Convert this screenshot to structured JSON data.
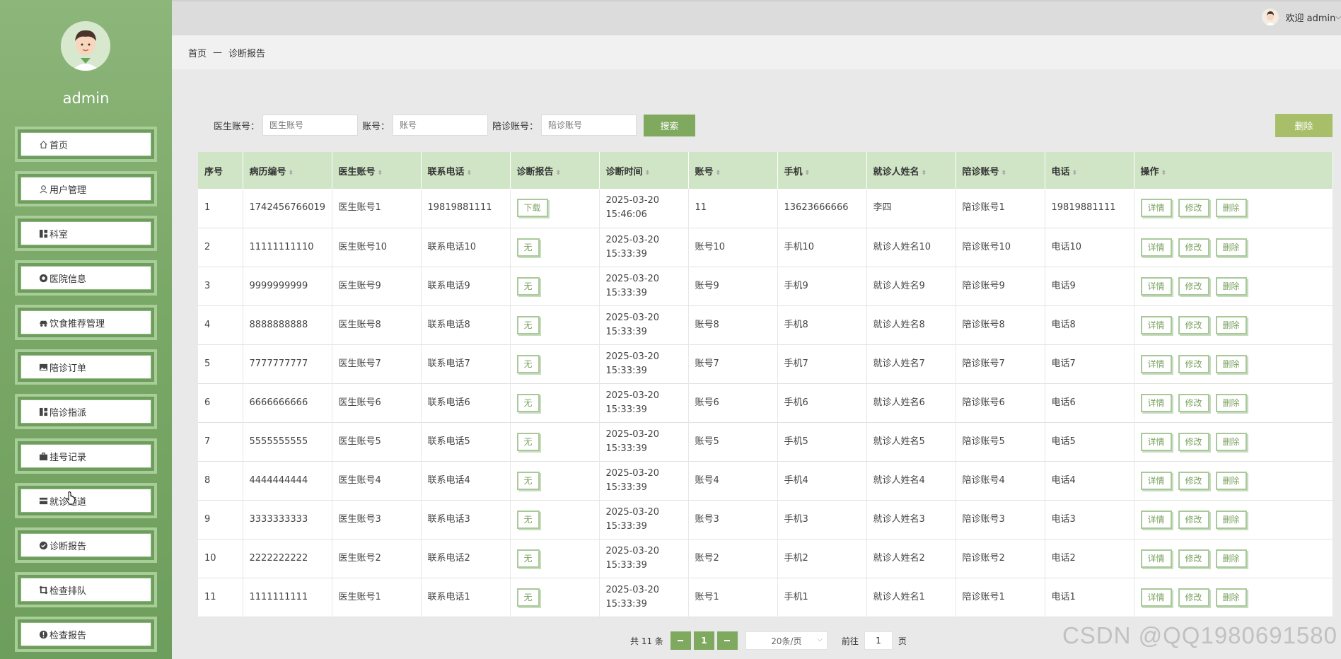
{
  "user": {
    "name": "admin",
    "welcome": "欢迎 admin"
  },
  "sidebar": {
    "items": [
      {
        "label": "首页",
        "icon": "home-icon"
      },
      {
        "label": "用户管理",
        "icon": "user-icon"
      },
      {
        "label": "科室",
        "icon": "grid-icon"
      },
      {
        "label": "医院信息",
        "icon": "info-icon"
      },
      {
        "label": "饮食推荐管理",
        "icon": "car-icon"
      },
      {
        "label": "陪诊订单",
        "icon": "image-icon"
      },
      {
        "label": "陪诊指派",
        "icon": "grid-icon"
      },
      {
        "label": "挂号记录",
        "icon": "bag-icon"
      },
      {
        "label": "就诊通道",
        "icon": "card-icon"
      },
      {
        "label": "诊断报告",
        "icon": "check-icon"
      },
      {
        "label": "检查排队",
        "icon": "crop-icon"
      },
      {
        "label": "检查报告",
        "icon": "alert-icon"
      }
    ]
  },
  "breadcrumb": {
    "home": "首页",
    "sep": "—",
    "current": "诊断报告"
  },
  "search": {
    "doctor_label": "医生账号：",
    "doctor_placeholder": "医生账号",
    "account_label": "账号：",
    "account_placeholder": "账号",
    "escort_label": "陪诊账号：",
    "escort_placeholder": "陪诊账号",
    "search_button": "搜索",
    "delete_button": "删除"
  },
  "table": {
    "headers": [
      "序号",
      "病历编号",
      "医生账号",
      "联系电话",
      "诊断报告",
      "诊断时间",
      "账号",
      "手机",
      "就诊人姓名",
      "陪诊账号",
      "电话",
      "操作"
    ],
    "actions": {
      "detail": "详情",
      "edit": "修改",
      "delete": "删除"
    },
    "rows": [
      [
        "1",
        "1742456766019",
        "医生账号1",
        "19819881111",
        "下载",
        "2025-03-20 15:46:06",
        "11",
        "13623666666",
        "李四",
        "陪诊账号1",
        "19819881111"
      ],
      [
        "2",
        "11111111110",
        "医生账号10",
        "联系电话10",
        "无",
        "2025-03-20 15:33:39",
        "账号10",
        "手机10",
        "就诊人姓名10",
        "陪诊账号10",
        "电话10"
      ],
      [
        "3",
        "9999999999",
        "医生账号9",
        "联系电话9",
        "无",
        "2025-03-20 15:33:39",
        "账号9",
        "手机9",
        "就诊人姓名9",
        "陪诊账号9",
        "电话9"
      ],
      [
        "4",
        "8888888888",
        "医生账号8",
        "联系电话8",
        "无",
        "2025-03-20 15:33:39",
        "账号8",
        "手机8",
        "就诊人姓名8",
        "陪诊账号8",
        "电话8"
      ],
      [
        "5",
        "7777777777",
        "医生账号7",
        "联系电话7",
        "无",
        "2025-03-20 15:33:39",
        "账号7",
        "手机7",
        "就诊人姓名7",
        "陪诊账号7",
        "电话7"
      ],
      [
        "6",
        "6666666666",
        "医生账号6",
        "联系电话6",
        "无",
        "2025-03-20 15:33:39",
        "账号6",
        "手机6",
        "就诊人姓名6",
        "陪诊账号6",
        "电话6"
      ],
      [
        "7",
        "5555555555",
        "医生账号5",
        "联系电话5",
        "无",
        "2025-03-20 15:33:39",
        "账号5",
        "手机5",
        "就诊人姓名5",
        "陪诊账号5",
        "电话5"
      ],
      [
        "8",
        "4444444444",
        "医生账号4",
        "联系电话4",
        "无",
        "2025-03-20 15:33:39",
        "账号4",
        "手机4",
        "就诊人姓名4",
        "陪诊账号4",
        "电话4"
      ],
      [
        "9",
        "3333333333",
        "医生账号3",
        "联系电话3",
        "无",
        "2025-03-20 15:33:39",
        "账号3",
        "手机3",
        "就诊人姓名3",
        "陪诊账号3",
        "电话3"
      ],
      [
        "10",
        "2222222222",
        "医生账号2",
        "联系电话2",
        "无",
        "2025-03-20 15:33:39",
        "账号2",
        "手机2",
        "就诊人姓名2",
        "陪诊账号2",
        "电话2"
      ],
      [
        "11",
        "1111111111",
        "医生账号1",
        "联系电话1",
        "无",
        "2025-03-20 15:33:39",
        "账号1",
        "手机1",
        "就诊人姓名1",
        "陪诊账号1",
        "电话1"
      ]
    ]
  },
  "pagination": {
    "total": "共 11 条",
    "prev": "◀",
    "page": "1",
    "next": "▶",
    "page_size": "20条/页",
    "goto_prefix": "前往",
    "goto_value": "1",
    "goto_suffix": "页"
  },
  "watermark": "CSDN @QQ1980691580",
  "colors": {
    "accent": "#7ea95f",
    "sidebar": "#7aa867",
    "header_row": "#d0e4c6",
    "delete_top": "#a8be68"
  }
}
